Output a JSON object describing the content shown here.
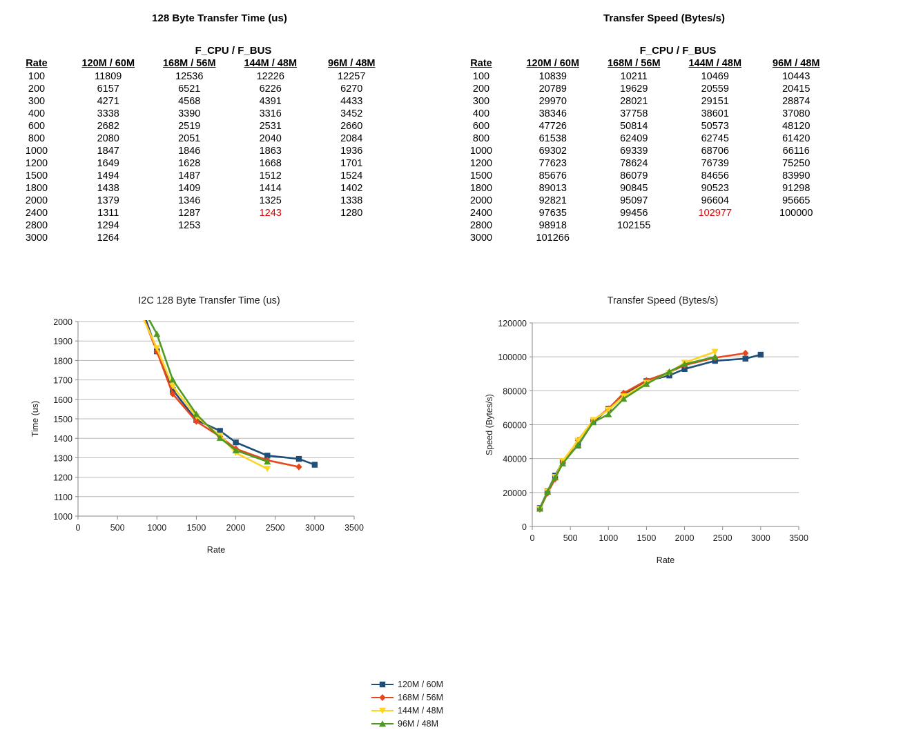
{
  "tables": [
    {
      "id": "time-table",
      "title": "128 Byte Transfer Time (us)",
      "group_header": "F_CPU / F_BUS",
      "columns": [
        "Rate",
        "120M / 60M",
        "168M / 56M",
        "144M / 48M",
        "96M / 48M"
      ],
      "rows": [
        {
          "rate": "100",
          "v": [
            "11809",
            "12536",
            "12226",
            "12257"
          ]
        },
        {
          "rate": "200",
          "v": [
            "6157",
            "6521",
            "6226",
            "6270"
          ]
        },
        {
          "rate": "300",
          "v": [
            "4271",
            "4568",
            "4391",
            "4433"
          ]
        },
        {
          "rate": "400",
          "v": [
            "3338",
            "3390",
            "3316",
            "3452"
          ]
        },
        {
          "rate": "600",
          "v": [
            "2682",
            "2519",
            "2531",
            "2660"
          ]
        },
        {
          "rate": "800",
          "v": [
            "2080",
            "2051",
            "2040",
            "2084"
          ]
        },
        {
          "rate": "1000",
          "v": [
            "1847",
            "1846",
            "1863",
            "1936"
          ]
        },
        {
          "rate": "1200",
          "v": [
            "1649",
            "1628",
            "1668",
            "1701"
          ]
        },
        {
          "rate": "1500",
          "v": [
            "1494",
            "1487",
            "1512",
            "1524"
          ]
        },
        {
          "rate": "1800",
          "v": [
            "1438",
            "1409",
            "1414",
            "1402"
          ]
        },
        {
          "rate": "2000",
          "v": [
            "1379",
            "1346",
            "1325",
            "1338"
          ]
        },
        {
          "rate": "2400",
          "v": [
            "1311",
            "1287",
            "1243",
            "1280"
          ],
          "highlight": [
            2
          ]
        },
        {
          "rate": "2800",
          "v": [
            "1294",
            "1253",
            "",
            ""
          ]
        },
        {
          "rate": "3000",
          "v": [
            "1264",
            "",
            "",
            ""
          ]
        }
      ]
    },
    {
      "id": "speed-table",
      "title": "Transfer Speed (Bytes/s)",
      "group_header": "F_CPU / F_BUS",
      "columns": [
        "Rate",
        "120M / 60M",
        "168M / 56M",
        "144M / 48M",
        "96M / 48M"
      ],
      "rows": [
        {
          "rate": "100",
          "v": [
            "10839",
            "10211",
            "10469",
            "10443"
          ]
        },
        {
          "rate": "200",
          "v": [
            "20789",
            "19629",
            "20559",
            "20415"
          ]
        },
        {
          "rate": "300",
          "v": [
            "29970",
            "28021",
            "29151",
            "28874"
          ]
        },
        {
          "rate": "400",
          "v": [
            "38346",
            "37758",
            "38601",
            "37080"
          ]
        },
        {
          "rate": "600",
          "v": [
            "47726",
            "50814",
            "50573",
            "48120"
          ]
        },
        {
          "rate": "800",
          "v": [
            "61538",
            "62409",
            "62745",
            "61420"
          ]
        },
        {
          "rate": "1000",
          "v": [
            "69302",
            "69339",
            "68706",
            "66116"
          ]
        },
        {
          "rate": "1200",
          "v": [
            "77623",
            "78624",
            "76739",
            "75250"
          ]
        },
        {
          "rate": "1500",
          "v": [
            "85676",
            "86079",
            "84656",
            "83990"
          ]
        },
        {
          "rate": "1800",
          "v": [
            "89013",
            "90845",
            "90523",
            "91298"
          ]
        },
        {
          "rate": "2000",
          "v": [
            "92821",
            "95097",
            "96604",
            "95665"
          ]
        },
        {
          "rate": "2400",
          "v": [
            "97635",
            "99456",
            "102977",
            "100000"
          ],
          "highlight": [
            2
          ]
        },
        {
          "rate": "2800",
          "v": [
            "98918",
            "102155",
            "",
            ""
          ]
        },
        {
          "rate": "3000",
          "v": [
            "101266",
            "",
            "",
            ""
          ]
        }
      ]
    }
  ],
  "colors": {
    "series1": "#1F4E79",
    "series2": "#E8471C",
    "series3": "#FFD320",
    "series4": "#4F9A22",
    "highlight": "#E00000",
    "grid": "#b8b8b8",
    "axis": "#868686",
    "tick_text": "#1a1a1a"
  },
  "chart_data": [
    {
      "id": "chart-time",
      "type": "line",
      "title": "I2C 128 Byte Transfer Time (us)",
      "xlabel": "Rate",
      "ylabel": "Time (us)",
      "xlim": [
        0,
        3500
      ],
      "ylim": [
        1000,
        2000
      ],
      "xticks": [
        0,
        500,
        1000,
        1500,
        2000,
        2500,
        3000,
        3500
      ],
      "yticks": [
        1000,
        1100,
        1200,
        1300,
        1400,
        1500,
        1600,
        1700,
        1800,
        1900,
        2000
      ],
      "grid": true,
      "legend_position": "right",
      "series": [
        {
          "name": "120M / 60M",
          "color": "#1F4E79",
          "marker": "square",
          "x": [
            100,
            200,
            300,
            400,
            600,
            800,
            1000,
            1200,
            1500,
            1800,
            2000,
            2400,
            2800,
            3000
          ],
          "values": [
            11809,
            6157,
            4271,
            3338,
            2682,
            2080,
            1847,
            1649,
            1494,
            1438,
            1379,
            1311,
            1294,
            1264
          ]
        },
        {
          "name": "168M / 56M",
          "color": "#E8471C",
          "marker": "diamond",
          "x": [
            100,
            200,
            300,
            400,
            600,
            800,
            1000,
            1200,
            1500,
            1800,
            2000,
            2400,
            2800
          ],
          "values": [
            12536,
            6521,
            4568,
            3390,
            2519,
            2051,
            1846,
            1628,
            1487,
            1409,
            1346,
            1287,
            1253
          ]
        },
        {
          "name": "144M / 48M",
          "color": "#FFD320",
          "marker": "triangle-down",
          "x": [
            100,
            200,
            300,
            400,
            600,
            800,
            1000,
            1200,
            1500,
            1800,
            2000,
            2400
          ],
          "values": [
            12226,
            6226,
            4391,
            3316,
            2531,
            2040,
            1863,
            1668,
            1512,
            1414,
            1325,
            1243
          ]
        },
        {
          "name": "96M / 48M",
          "color": "#4F9A22",
          "marker": "triangle-up",
          "x": [
            100,
            200,
            300,
            400,
            600,
            800,
            1000,
            1200,
            1500,
            1800,
            2000,
            2400
          ],
          "values": [
            12257,
            6270,
            4433,
            3452,
            2660,
            2084,
            1936,
            1701,
            1524,
            1402,
            1338,
            1280
          ]
        }
      ]
    },
    {
      "id": "chart-speed",
      "type": "line",
      "title": "Transfer Speed (Bytes/s)",
      "xlabel": "Rate",
      "ylabel": "Speed (Bytes/s)",
      "xlim": [
        0,
        3500
      ],
      "ylim": [
        0,
        120000
      ],
      "xticks": [
        0,
        500,
        1000,
        1500,
        2000,
        2500,
        3000,
        3500
      ],
      "yticks": [
        0,
        20000,
        40000,
        60000,
        80000,
        100000,
        120000
      ],
      "grid": true,
      "legend_position": "right",
      "series": [
        {
          "name": "120M / 60M",
          "color": "#1F4E79",
          "marker": "square",
          "x": [
            100,
            200,
            300,
            400,
            600,
            800,
            1000,
            1200,
            1500,
            1800,
            2000,
            2400,
            2800,
            3000
          ],
          "values": [
            10839,
            20789,
            29970,
            38346,
            47726,
            61538,
            69302,
            77623,
            85676,
            89013,
            92821,
            97635,
            98918,
            101266
          ]
        },
        {
          "name": "168M / 56M",
          "color": "#E8471C",
          "marker": "diamond",
          "x": [
            100,
            200,
            300,
            400,
            600,
            800,
            1000,
            1200,
            1500,
            1800,
            2000,
            2400,
            2800
          ],
          "values": [
            10211,
            19629,
            28021,
            37758,
            50814,
            62409,
            69339,
            78624,
            86079,
            90845,
            95097,
            99456,
            102155
          ]
        },
        {
          "name": "144M / 48M",
          "color": "#FFD320",
          "marker": "triangle-down",
          "x": [
            100,
            200,
            300,
            400,
            600,
            800,
            1000,
            1200,
            1500,
            1800,
            2000,
            2400
          ],
          "values": [
            10469,
            20559,
            29151,
            38601,
            50573,
            62745,
            68706,
            76739,
            84656,
            90523,
            96604,
            102977
          ]
        },
        {
          "name": "96M / 48M",
          "color": "#4F9A22",
          "marker": "triangle-up",
          "x": [
            100,
            200,
            300,
            400,
            600,
            800,
            1000,
            1200,
            1500,
            1800,
            2000,
            2400
          ],
          "values": [
            10443,
            20415,
            28874,
            37080,
            48120,
            61420,
            66116,
            75250,
            83990,
            91298,
            95665,
            100000
          ]
        }
      ]
    }
  ]
}
